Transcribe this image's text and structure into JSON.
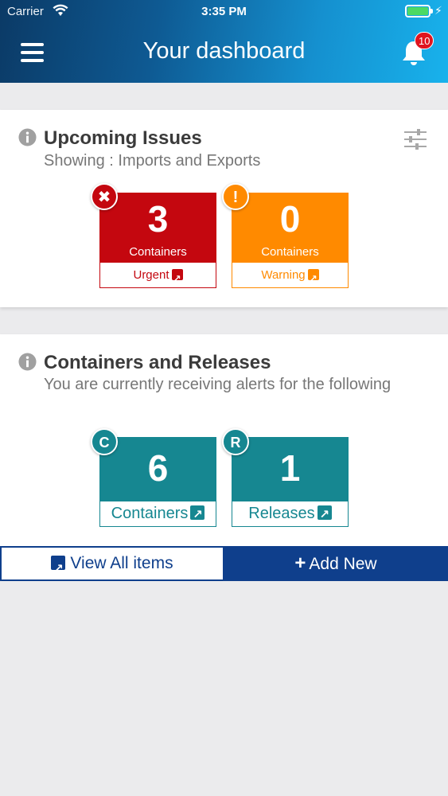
{
  "status_bar": {
    "carrier": "Carrier",
    "time": "3:35 PM"
  },
  "header": {
    "title": "Your dashboard",
    "notification_count": "10"
  },
  "upcoming": {
    "title": "Upcoming Issues",
    "subtitle": "Showing : Imports and Exports",
    "tiles": [
      {
        "count": "3",
        "label": "Containers",
        "footer": "Urgent",
        "badge": "✖"
      },
      {
        "count": "0",
        "label": "Containers",
        "footer": "Warning",
        "badge": "!"
      }
    ]
  },
  "containers": {
    "title": "Containers and Releases",
    "subtitle": "You are currently receiving alerts for the following",
    "tiles": [
      {
        "count": "6",
        "footer": "Containers",
        "badge": "C"
      },
      {
        "count": "1",
        "footer": "Releases",
        "badge": "R"
      }
    ]
  },
  "actions": {
    "view_all": "View All items",
    "add_new": "Add New"
  },
  "colors": {
    "urgent": "#c4070f",
    "warning": "#ff8a00",
    "teal": "#168791",
    "navy": "#0f3f8c"
  }
}
